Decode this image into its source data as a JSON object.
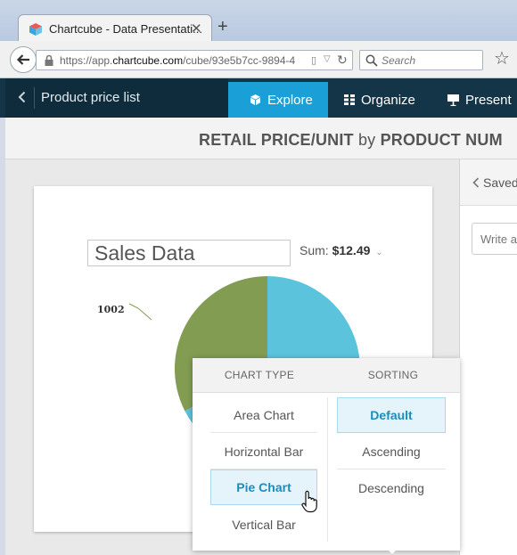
{
  "browser": {
    "tab_title": "Chartcube - Data Presentati...",
    "url_prefix": "https://app.",
    "url_domain": "chartcube.com",
    "url_rest": "/cube/93e5b7cc-9894-4",
    "search_placeholder": "Search",
    "new_tab_label": "+",
    "close_tab_label": "✕"
  },
  "app": {
    "back_label": "Product price list",
    "tabs": [
      {
        "label": "Explore",
        "icon": "cube-icon",
        "active": true
      },
      {
        "label": "Organize",
        "icon": "grid-icon"
      },
      {
        "label": "Present",
        "icon": "presentation-icon"
      }
    ]
  },
  "heading": {
    "metric": "RETAIL PRICE/UNIT",
    "by": "by",
    "dimension": "PRODUCT NUM"
  },
  "card": {
    "title_value": "Sales Data",
    "sum_label": "Sum:",
    "sum_value": "$12.49"
  },
  "chart_data": {
    "type": "pie",
    "slice_labels": [
      "1002"
    ],
    "colors": {
      "teal": "#5bc3dc",
      "olive": "#829c52"
    }
  },
  "side_panel": {
    "saved_label": "Saved",
    "note_placeholder": "Write a"
  },
  "popup": {
    "chart_type_header": "CHART TYPE",
    "sorting_header": "SORTING",
    "chart_types": [
      "Area Chart",
      "Horizontal Bar",
      "Pie Chart",
      "Vertical Bar"
    ],
    "selected_chart_type": "Pie Chart",
    "sorting": [
      "Default",
      "Ascending",
      "Descending"
    ],
    "selected_sorting": "Default"
  },
  "colors": {
    "accent": "#1aa0d6",
    "header_bg": "#143547",
    "selected_bg": "#e4f4fa",
    "selected_text": "#1b8dbd"
  }
}
